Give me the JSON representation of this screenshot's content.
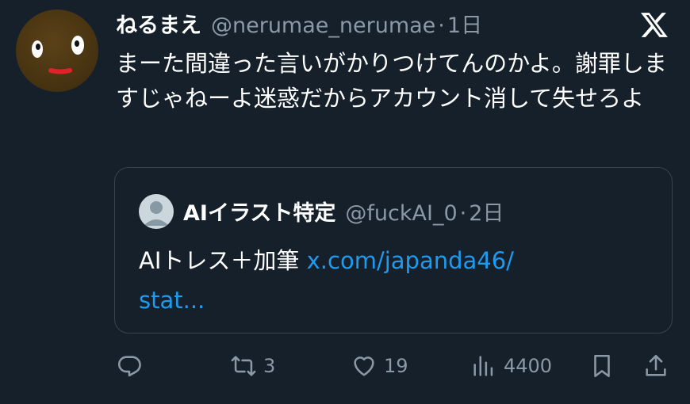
{
  "tweet": {
    "display_name": "ねるまえ",
    "handle": "@nerumae_nerumae",
    "separator": "·",
    "time": "1日",
    "text": "まーた間違った言いがかりつけてんのかよ。謝罪しますじゃねーよ迷惑だからアカウント消して失せろよ"
  },
  "quote": {
    "display_name": "AIイラスト特定",
    "handle": "@fuckAI_0",
    "separator": "·",
    "time": "2日",
    "text": "AIトレス＋加筆 ",
    "link_text": "x.com/japanda46/\nstat..."
  },
  "actions": {
    "reply_icon": "reply-icon",
    "retweet_icon": "retweet-icon",
    "retweet_count": "3",
    "like_icon": "heart-icon",
    "like_count": "19",
    "views_icon": "views-icon",
    "views_count": "4400",
    "bookmark_icon": "bookmark-icon",
    "share_icon": "share-icon"
  },
  "colors": {
    "background": "#15202b",
    "secondary_text": "#8b98a5",
    "link": "#1d9bf0",
    "border": "#38444d"
  }
}
